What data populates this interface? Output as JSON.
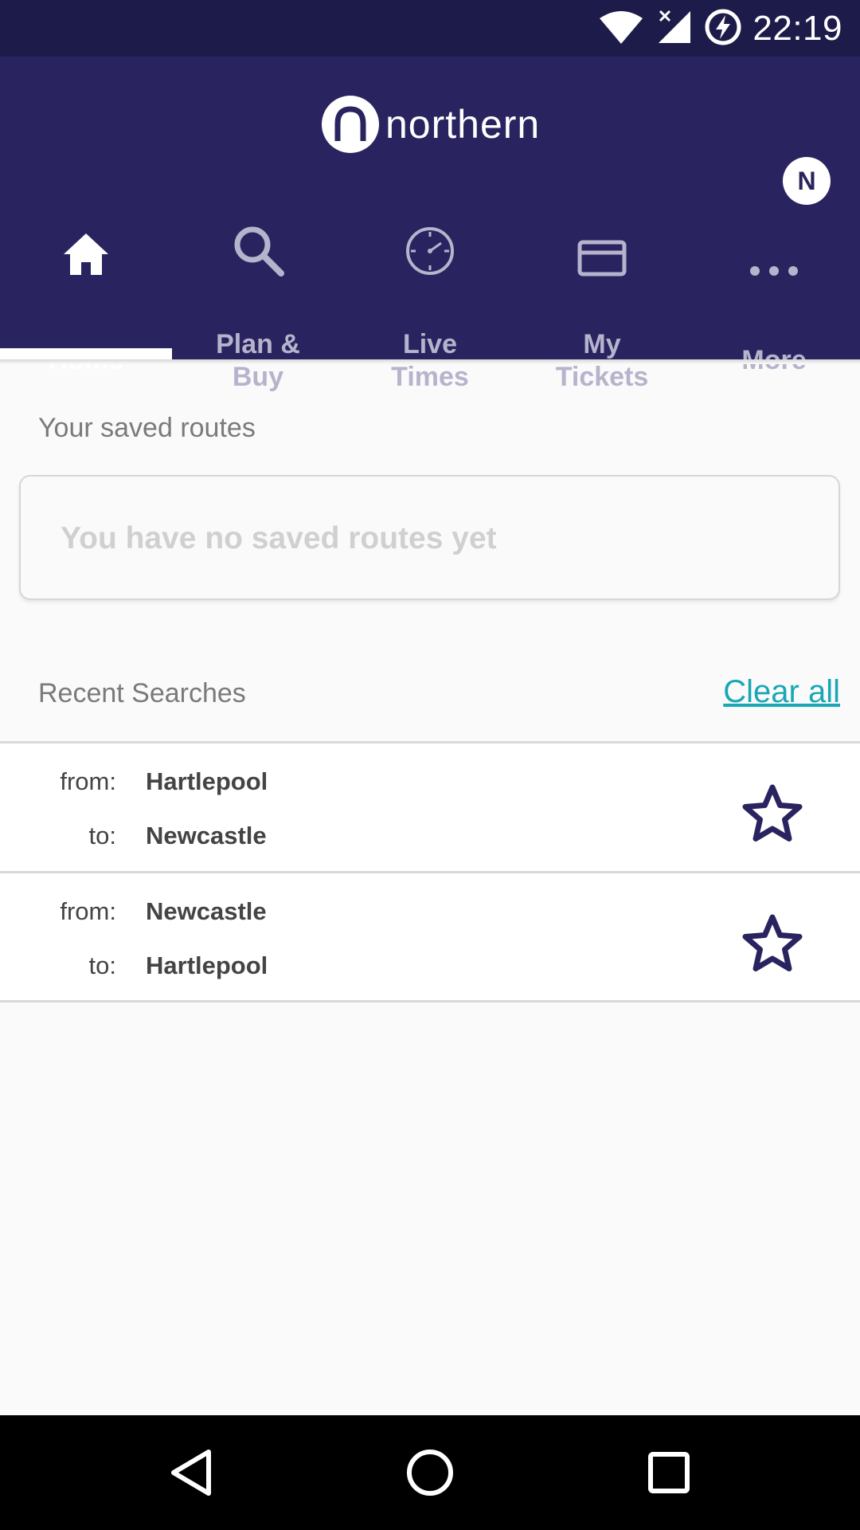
{
  "status_bar": {
    "time": "22:19",
    "icons": [
      "wifi-icon",
      "signal-icon",
      "battery-charging-icon"
    ]
  },
  "header": {
    "brand": "northern",
    "avatar_initial": "N"
  },
  "tabs": [
    {
      "label": "Home",
      "icon": "home-icon",
      "active": true
    },
    {
      "label": "Plan & Buy",
      "icon": "search-icon",
      "active": false
    },
    {
      "label": "Live Times",
      "icon": "clock-icon",
      "active": false
    },
    {
      "label": "My Tickets",
      "icon": "ticket-icon",
      "active": false
    },
    {
      "label": "More",
      "icon": "more-dots-icon",
      "active": false
    }
  ],
  "saved_routes": {
    "title": "Your saved routes",
    "empty_message": "You have no saved routes yet"
  },
  "recent_searches": {
    "title": "Recent Searches",
    "clear_label": "Clear all",
    "from_label": "from:",
    "to_label": "to:",
    "items": [
      {
        "from": "Hartlepool",
        "to": "Newcastle"
      },
      {
        "from": "Newcastle",
        "to": "Hartlepool"
      }
    ]
  },
  "colors": {
    "brand": "#29245f",
    "status_bar": "#1d1b4a",
    "accent_link": "#19a7b5"
  },
  "nav_bar": [
    "back-icon",
    "home-circle-icon",
    "recents-square-icon"
  ]
}
